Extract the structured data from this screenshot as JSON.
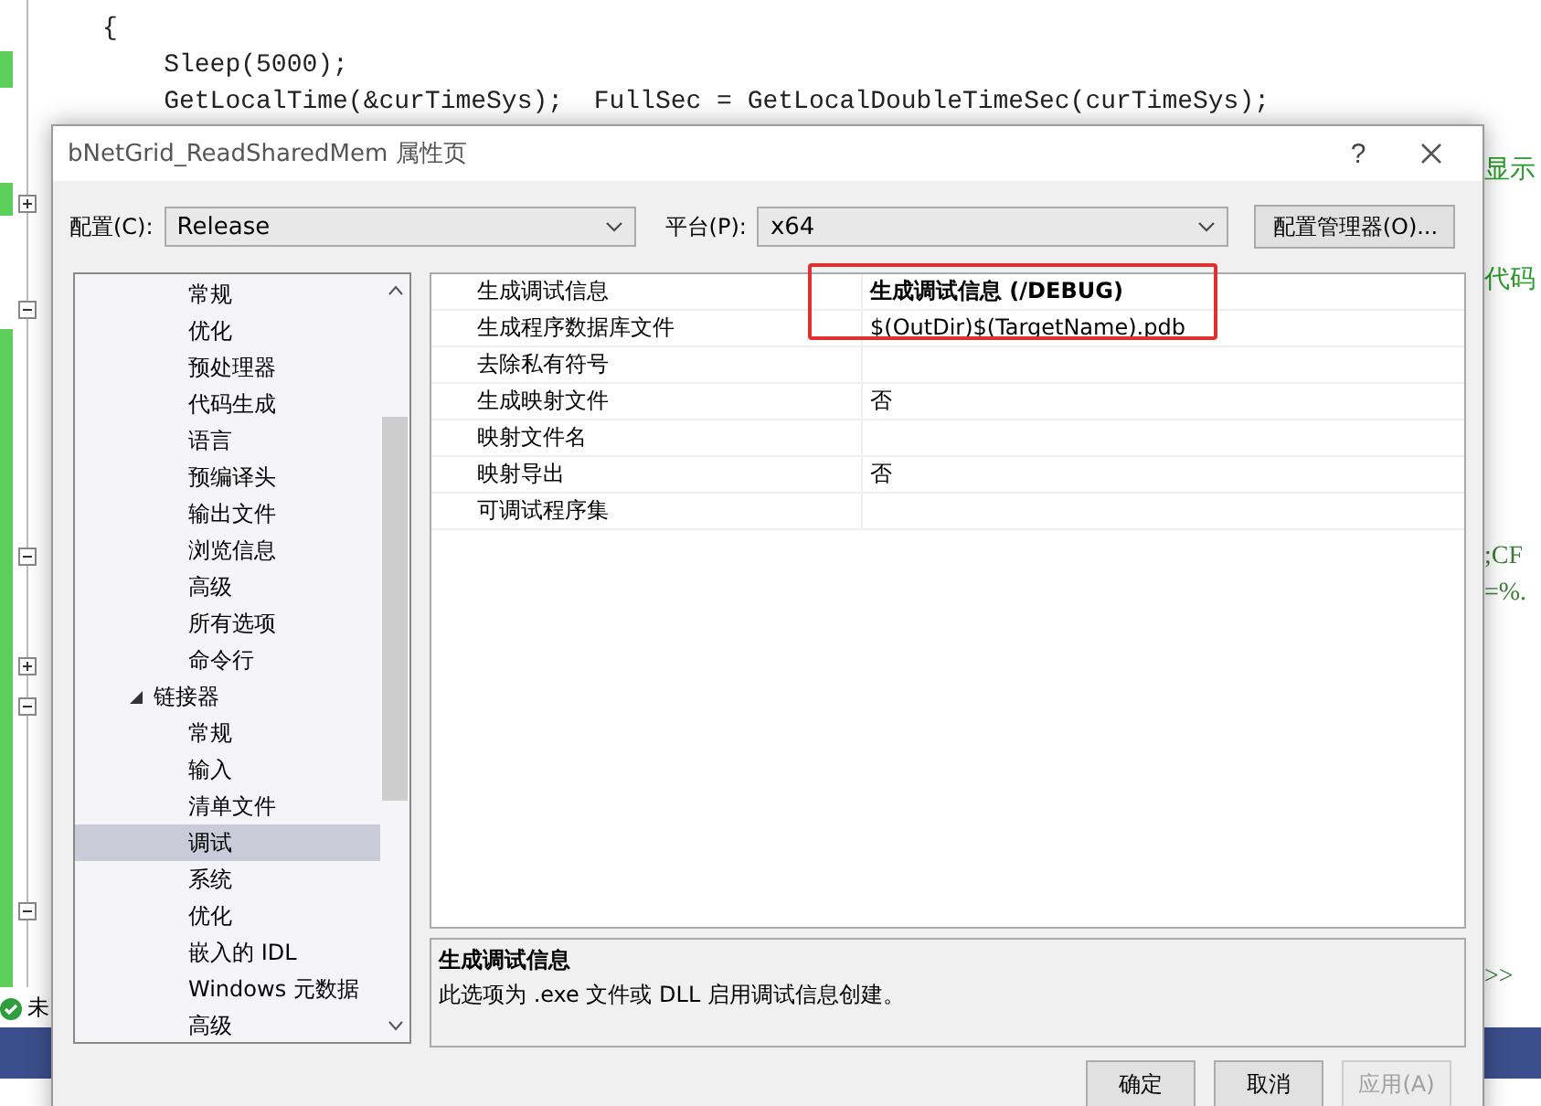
{
  "editor": {
    "code_lines": [
      "{",
      "    Sleep(5000);",
      "    GetLocalTime(&curTimeSys);  FullSec = GetLocalDoubleTimeSec(curTimeSys);"
    ],
    "side_fragments": [
      {
        "text": "显示",
        "kind": "comment"
      },
      {
        "text": "代码",
        "kind": "comment"
      },
      {
        "text": ";CF",
        "kind": "code"
      },
      {
        "text": "=%.",
        "kind": "code"
      },
      {
        "text": ">>",
        "kind": "code"
      }
    ],
    "status": "未"
  },
  "dialog": {
    "title": "bNetGrid_ReadSharedMem 属性页",
    "help": "?",
    "config": {
      "label": "配置(C):",
      "value": "Release"
    },
    "platform": {
      "label": "平台(P):",
      "value": "x64"
    },
    "manager_button": "配置管理器(O)...",
    "tree": [
      {
        "label": "常规",
        "selected": false
      },
      {
        "label": "优化",
        "selected": false
      },
      {
        "label": "预处理器",
        "selected": false
      },
      {
        "label": "代码生成",
        "selected": false
      },
      {
        "label": "语言",
        "selected": false
      },
      {
        "label": "预编译头",
        "selected": false
      },
      {
        "label": "输出文件",
        "selected": false
      },
      {
        "label": "浏览信息",
        "selected": false
      },
      {
        "label": "高级",
        "selected": false
      },
      {
        "label": "所有选项",
        "selected": false
      },
      {
        "label": "命令行",
        "selected": false
      },
      {
        "label": "链接器",
        "selected": false,
        "expanded": true,
        "children": [
          {
            "label": "常规",
            "selected": false
          },
          {
            "label": "输入",
            "selected": false
          },
          {
            "label": "清单文件",
            "selected": false
          },
          {
            "label": "调试",
            "selected": true
          },
          {
            "label": "系统",
            "selected": false
          },
          {
            "label": "优化",
            "selected": false
          },
          {
            "label": "嵌入的 IDL",
            "selected": false
          },
          {
            "label": "Windows 元数据",
            "selected": false
          },
          {
            "label": "高级",
            "selected": false
          }
        ]
      }
    ],
    "properties": [
      {
        "name": "生成调试信息",
        "value": "生成调试信息 (/DEBUG)",
        "non_default": true
      },
      {
        "name": "生成程序数据库文件",
        "value": "$(OutDir)$(TargetName).pdb",
        "non_default": false
      },
      {
        "name": "去除私有符号"
      },
      {
        "name": "生成映射文件",
        "value": "否",
        "non_default": false
      },
      {
        "name": "映射文件名"
      },
      {
        "name": "映射导出",
        "value": "否",
        "non_default": false
      },
      {
        "name": "可调试程序集"
      }
    ],
    "description": {
      "title": "生成调试信息",
      "text": "此选项为 .exe 文件或 DLL 启用调试信息创建。"
    },
    "buttons": [
      {
        "label": "确定",
        "disabled": false
      },
      {
        "label": "取消",
        "disabled": false
      },
      {
        "label": "应用(A)",
        "disabled": true
      }
    ]
  }
}
